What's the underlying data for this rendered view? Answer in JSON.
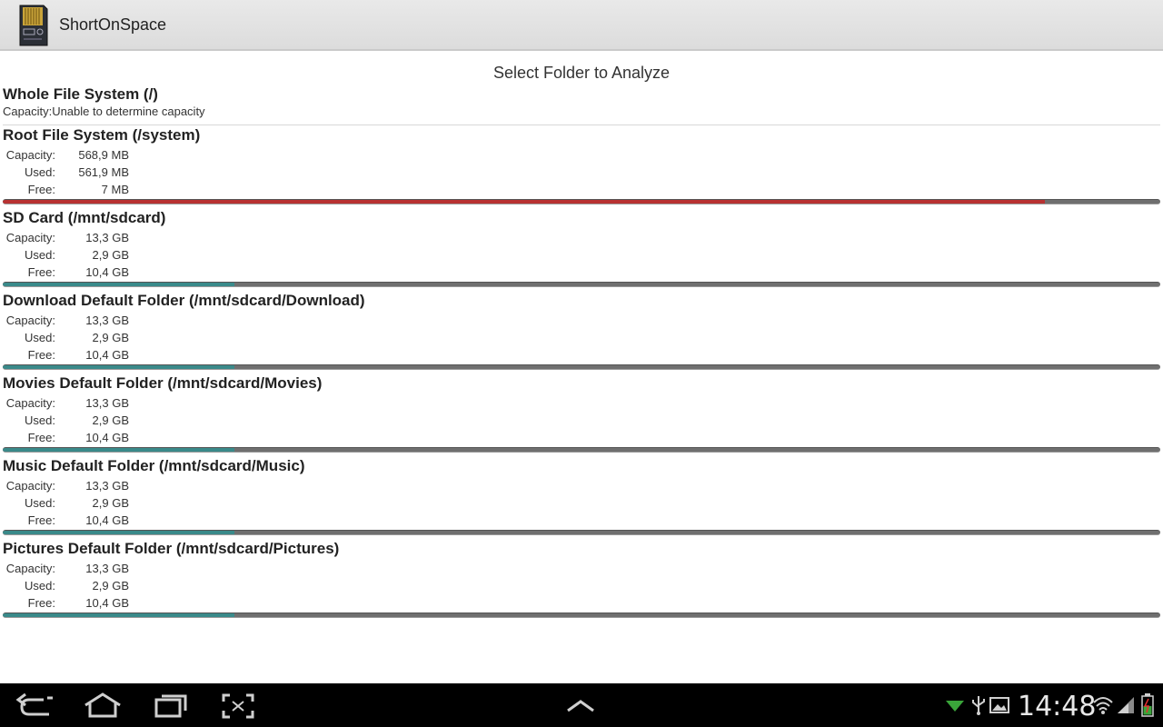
{
  "app": {
    "title": "ShortOnSpace",
    "icon": "sd-card-icon"
  },
  "header": {
    "text": "Select Folder to Analyze"
  },
  "labels": {
    "capacity": "Capacity:",
    "used": "Used:",
    "free": "Free:"
  },
  "colors": {
    "critical_fill": "#b83232",
    "normal_fill": "#3a8a8a",
    "track": "#6f6f6f"
  },
  "whole_fs": {
    "title": "Whole File System (/)",
    "capacity_text": "Capacity:Unable to determine capacity"
  },
  "folders": [
    {
      "title": "Root File System (/system)",
      "capacity": "568,9 MB",
      "used": "561,9 MB",
      "free": "7 MB",
      "used_fraction": 0.9,
      "status": "critical"
    },
    {
      "title": "SD Card (/mnt/sdcard)",
      "capacity": "13,3 GB",
      "used": "2,9 GB",
      "free": "10,4 GB",
      "used_fraction": 0.2,
      "status": "normal"
    },
    {
      "title": "Download Default Folder (/mnt/sdcard/Download)",
      "capacity": "13,3 GB",
      "used": "2,9 GB",
      "free": "10,4 GB",
      "used_fraction": 0.2,
      "status": "normal"
    },
    {
      "title": "Movies Default Folder (/mnt/sdcard/Movies)",
      "capacity": "13,3 GB",
      "used": "2,9 GB",
      "free": "10,4 GB",
      "used_fraction": 0.2,
      "status": "normal"
    },
    {
      "title": "Music Default Folder (/mnt/sdcard/Music)",
      "capacity": "13,3 GB",
      "used": "2,9 GB",
      "free": "10,4 GB",
      "used_fraction": 0.2,
      "status": "normal"
    },
    {
      "title": "Pictures Default Folder (/mnt/sdcard/Pictures)",
      "capacity": "13,3 GB",
      "used": "2,9 GB",
      "free": "10,4 GB",
      "used_fraction": 0.2,
      "status": "normal"
    }
  ],
  "navbar": {
    "buttons": [
      "back-icon",
      "home-icon",
      "recent-apps-icon",
      "screenshot-icon",
      "menu-up-icon"
    ],
    "status_icons": [
      "notification-icon",
      "usb-icon",
      "gallery-icon",
      "wifi-icon",
      "signal-icon",
      "battery-icon"
    ],
    "time": "14:48"
  }
}
